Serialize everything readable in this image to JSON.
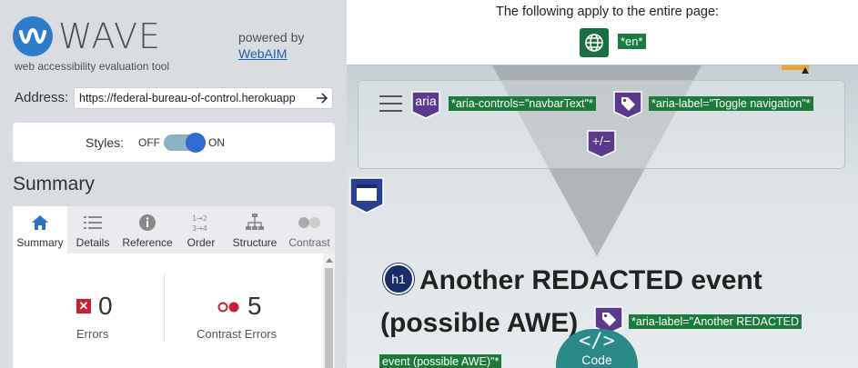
{
  "sidebar": {
    "logo_word": "WAVE",
    "tagline": "web accessibility evaluation tool",
    "powered_by": "powered by",
    "webaim_link": "WebAIM",
    "address_label": "Address:",
    "address_value": "https://federal-bureau-of-control.herokuapp",
    "styles_label": "Styles:",
    "styles_off": "OFF",
    "styles_on": "ON",
    "styles_enabled": true,
    "summary_title": "Summary",
    "tabs": [
      {
        "label": "Summary",
        "icon": "home-icon",
        "active": true
      },
      {
        "label": "Details",
        "icon": "list-icon",
        "active": false
      },
      {
        "label": "Reference",
        "icon": "info-icon",
        "active": false
      },
      {
        "label": "Order",
        "icon": "order-icon",
        "active": false
      },
      {
        "label": "Structure",
        "icon": "structure-icon",
        "active": false
      },
      {
        "label": "Contrast",
        "icon": "contrast-icon",
        "active": false
      }
    ],
    "errors": {
      "count": "0",
      "label": "Errors"
    },
    "contrast_errors": {
      "count": "5",
      "label": "Contrast Errors"
    }
  },
  "page": {
    "banner_text": "The following apply to the entire page:",
    "lang_tag": "*en*",
    "navbar_tags": {
      "aria_icon_text": "aria",
      "aria_controls": "*aria-controls=\"navbarText\"*",
      "aria_label": "*aria-label=\"Toggle navigation\"*",
      "plusminus_text": "+/−"
    },
    "h1_badge": "h1",
    "heading_text": "Another REDACTED event (possible AWE)",
    "heading_aria_label_line1": "*aria-label=\"Another REDACTED",
    "heading_aria_label_line2": "event (possible AWE)\"*",
    "code_button_symbol": "</>",
    "code_button_label": "Code"
  },
  "colors": {
    "wave_blue": "#2e7bc9",
    "error_red": "#c8202f",
    "tag_green": "#1b7a3c",
    "aria_purple": "#5b3a8c",
    "code_teal": "#2b8a87"
  }
}
